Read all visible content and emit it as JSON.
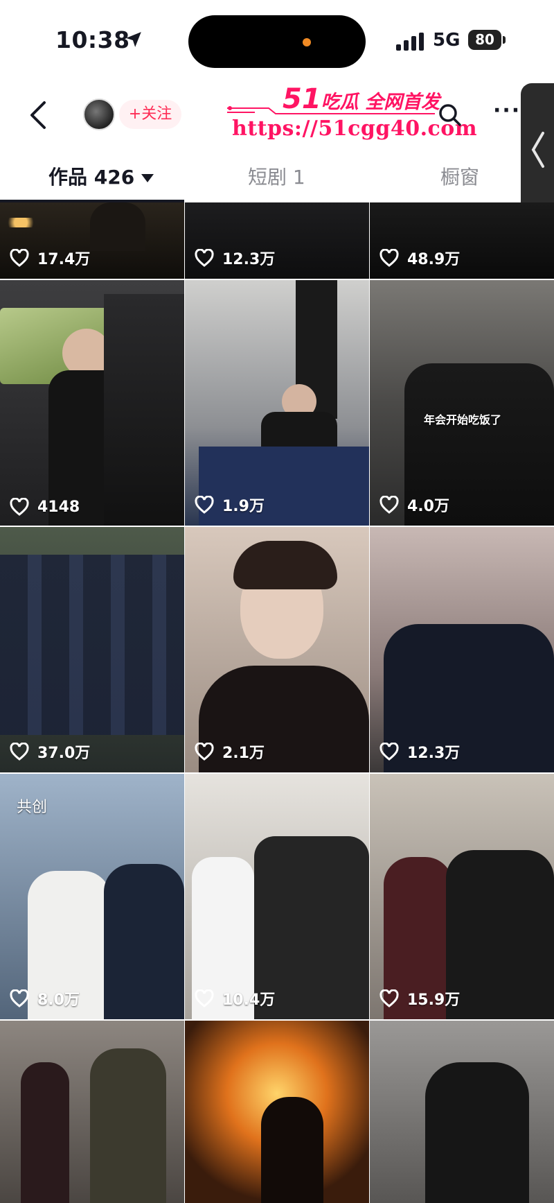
{
  "status_bar": {
    "time": "10:38",
    "network": "5G",
    "battery": "80"
  },
  "header": {
    "follow_label": "+关注",
    "watermark_title_num": "51",
    "watermark_title_text": "吃瓜 全网首发",
    "watermark_url": "https://51cgg40.com"
  },
  "tabs": {
    "works": "作品 426",
    "drama": "短剧 1",
    "shop": "橱窗"
  },
  "grid": {
    "tiles": [
      {
        "likes": "17.4万"
      },
      {
        "likes": "12.3万"
      },
      {
        "likes": "48.9万"
      },
      {
        "likes": "4148"
      },
      {
        "likes": "1.9万"
      },
      {
        "likes": "4.0万",
        "caption": "年会开始吃饭了"
      },
      {
        "likes": "37.0万"
      },
      {
        "likes": "2.1万"
      },
      {
        "likes": "12.3万"
      },
      {
        "likes": "8.0万",
        "badge": "共创"
      },
      {
        "likes": "10.4万"
      },
      {
        "likes": "15.9万"
      },
      {
        "likes": ""
      },
      {
        "likes": ""
      },
      {
        "likes": ""
      }
    ]
  },
  "colors": {
    "accent": "#fe2c55",
    "watermark": "#ff1463"
  }
}
